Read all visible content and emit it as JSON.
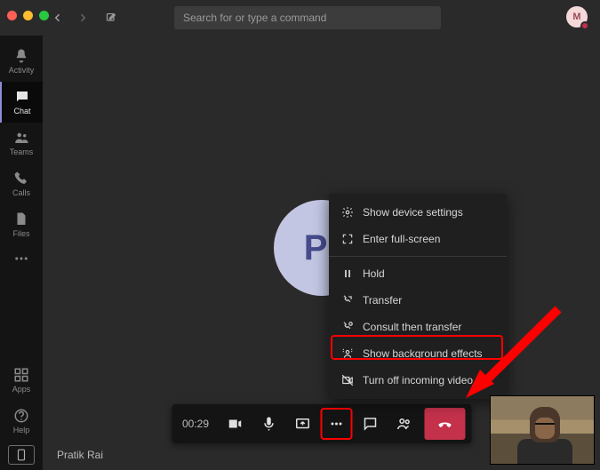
{
  "search": {
    "placeholder": "Search for or type a command"
  },
  "avatar": {
    "initial": "M"
  },
  "rail": {
    "items": [
      {
        "label": "Activity"
      },
      {
        "label": "Chat"
      },
      {
        "label": "Teams"
      },
      {
        "label": "Calls"
      },
      {
        "label": "Files"
      }
    ],
    "apps_label": "Apps",
    "help_label": "Help"
  },
  "call": {
    "participant_initials": "PR",
    "participant_name": "Pratik Rai",
    "timer": "00:29"
  },
  "menu": {
    "items": [
      "Show device settings",
      "Enter full-screen",
      "Hold",
      "Transfer",
      "Consult then transfer",
      "Show background effects",
      "Turn off incoming video"
    ]
  }
}
